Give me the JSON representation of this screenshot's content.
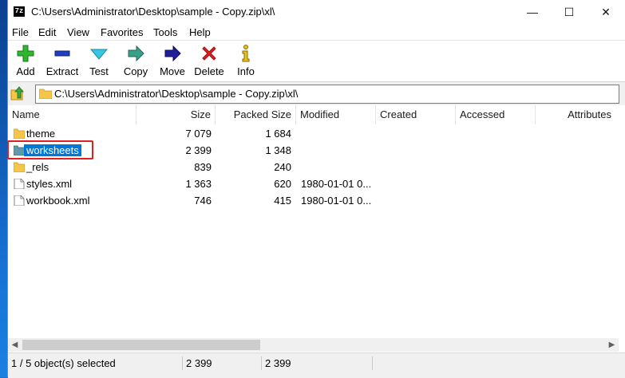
{
  "window": {
    "title": "C:\\Users\\Administrator\\Desktop\\sample -  Copy.zip\\xl\\",
    "app_icon_text": "7z",
    "minimize": "—",
    "maximize": "☐",
    "close": "✕"
  },
  "menu": [
    "File",
    "Edit",
    "View",
    "Favorites",
    "Tools",
    "Help"
  ],
  "toolbar": [
    {
      "label": "Add",
      "icon": "plus-icon"
    },
    {
      "label": "Extract",
      "icon": "minus-icon"
    },
    {
      "label": "Test",
      "icon": "check-icon"
    },
    {
      "label": "Copy",
      "icon": "copy-arrow-icon"
    },
    {
      "label": "Move",
      "icon": "move-arrow-icon"
    },
    {
      "label": "Delete",
      "icon": "delete-x-icon"
    },
    {
      "label": "Info",
      "icon": "info-icon"
    }
  ],
  "address": {
    "path": "C:\\Users\\Administrator\\Desktop\\sample -  Copy.zip\\xl\\"
  },
  "columns": [
    "Name",
    "Size",
    "Packed Size",
    "Modified",
    "Created",
    "Accessed",
    "Attributes"
  ],
  "rows": [
    {
      "type": "folder",
      "name": "theme",
      "size": "7 079",
      "packed": "1 684",
      "modified": "",
      "selected": false
    },
    {
      "type": "folder",
      "name": "worksheets",
      "size": "2 399",
      "packed": "1 348",
      "modified": "",
      "selected": true
    },
    {
      "type": "folder",
      "name": "_rels",
      "size": "839",
      "packed": "240",
      "modified": "",
      "selected": false
    },
    {
      "type": "file",
      "name": "styles.xml",
      "size": "1 363",
      "packed": "620",
      "modified": "1980-01-01 0...",
      "selected": false
    },
    {
      "type": "file",
      "name": "workbook.xml",
      "size": "746",
      "packed": "415",
      "modified": "1980-01-01 0...",
      "selected": false
    }
  ],
  "status": {
    "selection": "1 / 5 object(s) selected",
    "size": "2 399",
    "packed": "2 399"
  },
  "colors": {
    "selection": "#0078d7",
    "highlight_box": "#e02020",
    "folder": "#f5c64a"
  }
}
